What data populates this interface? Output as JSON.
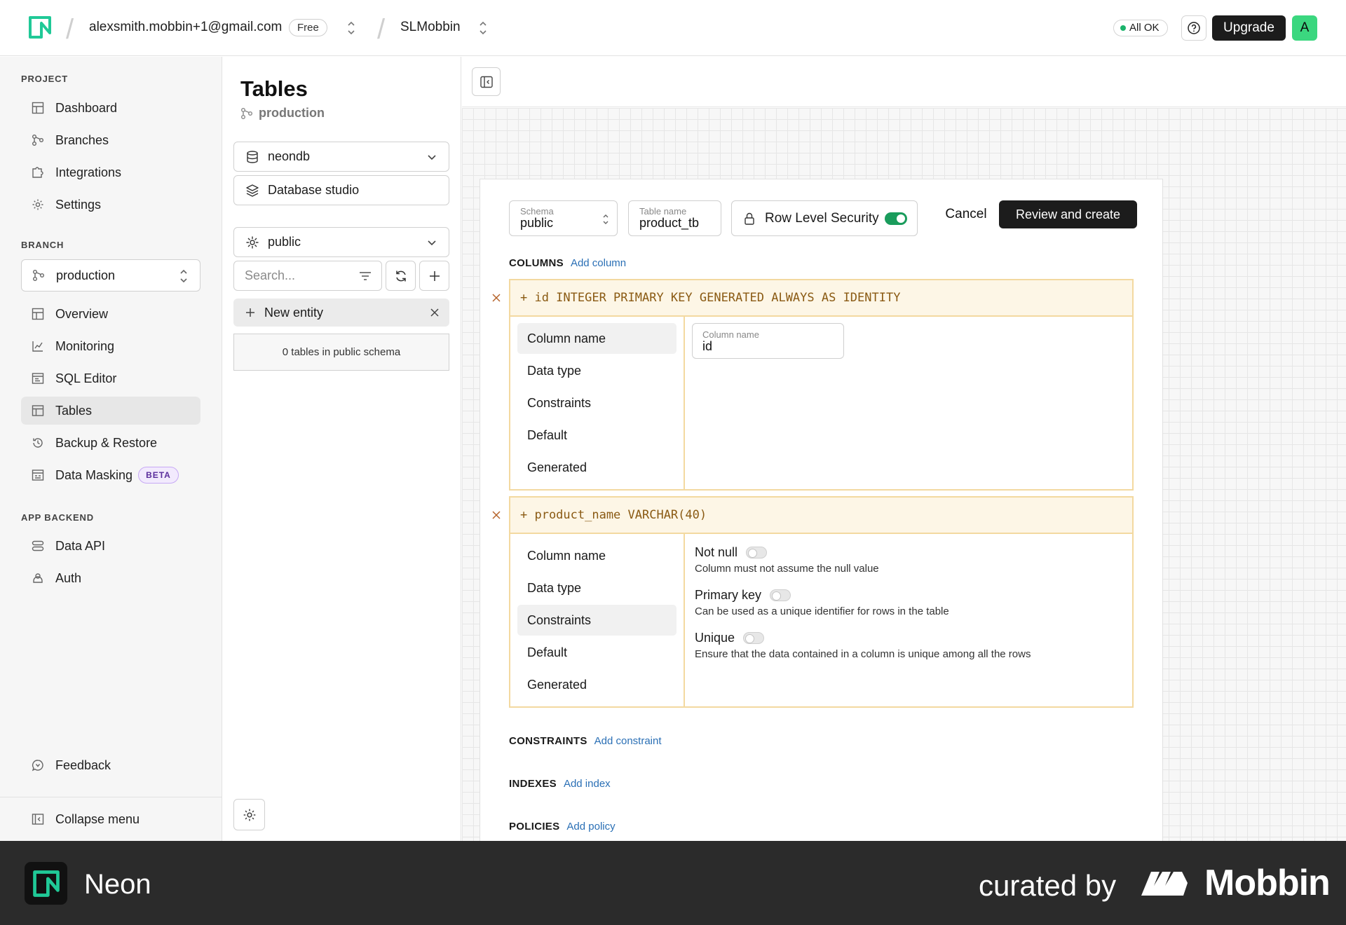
{
  "topbar": {
    "account_email": "alexsmith.mobbin+1@gmail.com",
    "plan_badge": "Free",
    "project_name": "SLMobbin",
    "status": "All OK",
    "upgrade_label": "Upgrade",
    "avatar_letter": "A"
  },
  "sidebar": {
    "project_label": "PROJECT",
    "project_items": [
      {
        "label": "Dashboard",
        "icon": "grid-icon"
      },
      {
        "label": "Branches",
        "icon": "branch-icon"
      },
      {
        "label": "Integrations",
        "icon": "puzzle-icon"
      },
      {
        "label": "Settings",
        "icon": "gear-icon"
      }
    ],
    "branch_label": "BRANCH",
    "branch_selected": "production",
    "branch_items": [
      {
        "label": "Overview",
        "icon": "grid-icon"
      },
      {
        "label": "Monitoring",
        "icon": "chart-icon"
      },
      {
        "label": "SQL Editor",
        "icon": "sql-icon"
      },
      {
        "label": "Tables",
        "icon": "table-icon"
      },
      {
        "label": "Backup & Restore",
        "icon": "history-icon"
      },
      {
        "label": "Data Masking",
        "icon": "mask-icon",
        "badge": "BETA"
      }
    ],
    "backend_label": "APP BACKEND",
    "backend_items": [
      {
        "label": "Data API",
        "icon": "api-icon"
      },
      {
        "label": "Auth",
        "icon": "auth-icon"
      }
    ],
    "feedback_label": "Feedback",
    "collapse_label": "Collapse menu"
  },
  "tables_panel": {
    "title": "Tables",
    "branch": "production",
    "database": "neondb",
    "studio_label": "Database studio",
    "schema": "public",
    "search_placeholder": "Search...",
    "new_entity_label": "New entity",
    "count_text": "0 tables in public schema"
  },
  "editor": {
    "schema_label": "Schema",
    "schema_value": "public",
    "table_name_label": "Table name",
    "table_name_value": "product_tb",
    "rls_label": "Row Level Security",
    "rls_enabled": true,
    "cancel_label": "Cancel",
    "review_label": "Review and create",
    "columns_label": "COLUMNS",
    "add_column": "Add column",
    "columns": [
      {
        "definition": "+ id INTEGER PRIMARY KEY GENERATED ALWAYS AS IDENTITY",
        "tabs": [
          "Column name",
          "Data type",
          "Constraints",
          "Default",
          "Generated"
        ],
        "active_tab": "Column name",
        "field_label": "Column name",
        "field_value": "id"
      },
      {
        "definition": "+ product_name VARCHAR(40)",
        "tabs": [
          "Column name",
          "Data type",
          "Constraints",
          "Default",
          "Generated"
        ],
        "active_tab": "Constraints",
        "options": [
          {
            "title": "Not null",
            "desc": "Column must not assume the null value",
            "enabled": false
          },
          {
            "title": "Primary key",
            "desc": "Can be used as a unique identifier for rows in the table",
            "enabled": false
          },
          {
            "title": "Unique",
            "desc": "Ensure that the data contained in a column is unique among all the rows",
            "enabled": false
          }
        ]
      }
    ],
    "constraints_label": "CONSTRAINTS",
    "add_constraint": "Add constraint",
    "indexes_label": "INDEXES",
    "add_index": "Add index",
    "policies_label": "POLICIES",
    "add_policy": "Add policy"
  },
  "banner": {
    "app_name": "Neon",
    "curated_by": "curated by",
    "brand": "Mobbin"
  },
  "colors": {
    "accent_green": "#3bd77f",
    "toggle_green": "#1a9c5c",
    "link_blue": "#2a6fb5",
    "column_border": "#f3d9a0"
  }
}
